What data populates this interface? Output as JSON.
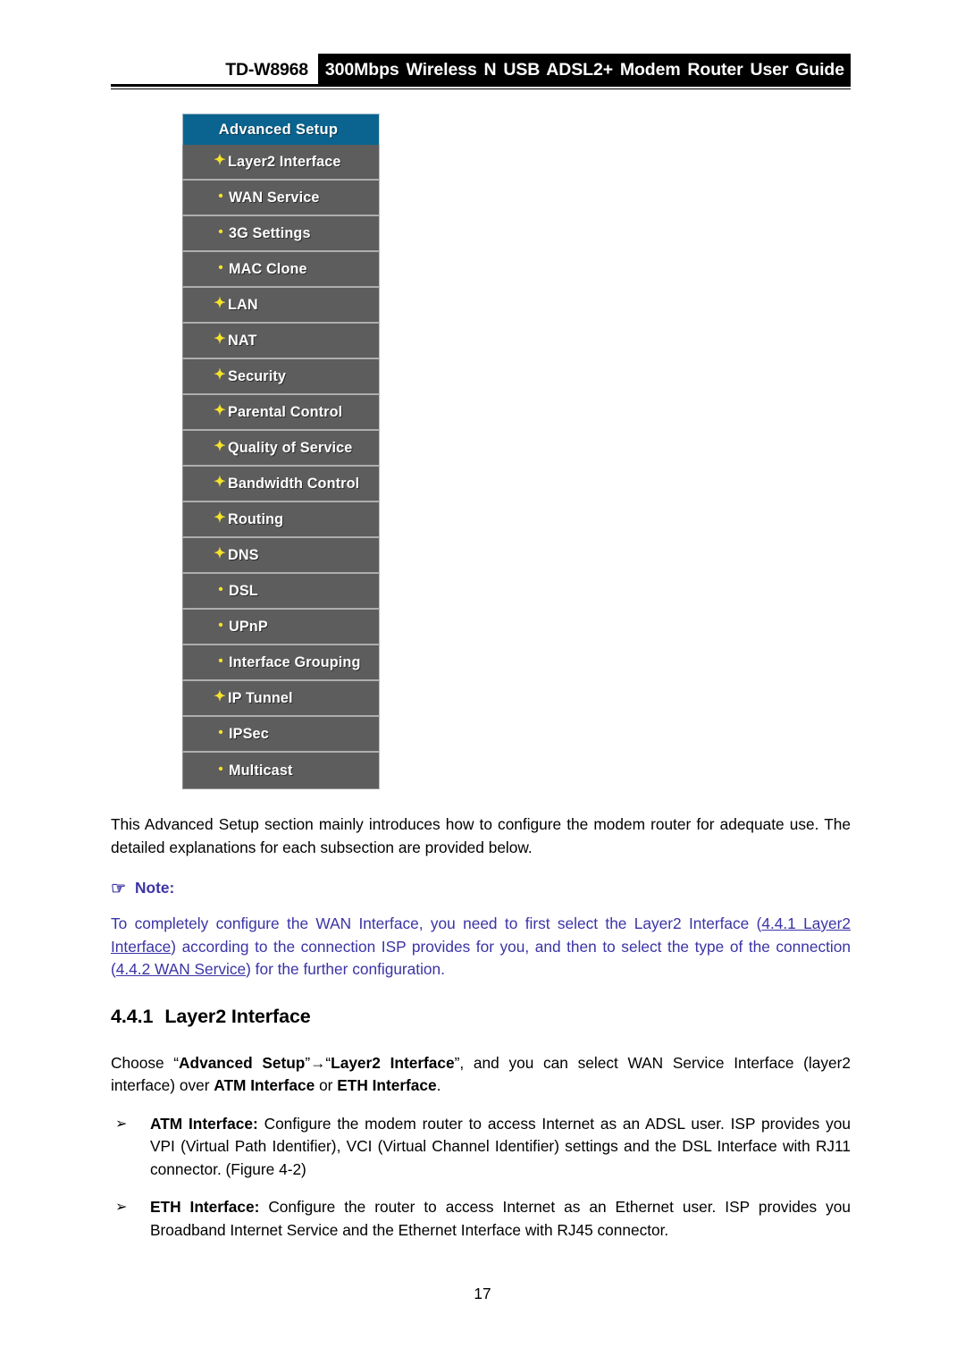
{
  "header": {
    "model": "TD-W8968",
    "title": "300Mbps Wireless N USB ADSL2+ Modem Router User Guide"
  },
  "menu": {
    "title": "Advanced Setup",
    "items": [
      {
        "label": "Layer2 Interface",
        "marker": "+",
        "marker_glyph": "✦"
      },
      {
        "label": "WAN Service",
        "marker": "•",
        "marker_glyph": "•"
      },
      {
        "label": "3G Settings",
        "marker": "•",
        "marker_glyph": "•"
      },
      {
        "label": "MAC Clone",
        "marker": "•",
        "marker_glyph": "•"
      },
      {
        "label": "LAN",
        "marker": "+",
        "marker_glyph": "✦"
      },
      {
        "label": "NAT",
        "marker": "+",
        "marker_glyph": "✦"
      },
      {
        "label": "Security",
        "marker": "+",
        "marker_glyph": "✦"
      },
      {
        "label": "Parental Control",
        "marker": "+",
        "marker_glyph": "✦"
      },
      {
        "label": "Quality of Service",
        "marker": "+",
        "marker_glyph": "✦"
      },
      {
        "label": "Bandwidth Control",
        "marker": "+",
        "marker_glyph": "✦"
      },
      {
        "label": "Routing",
        "marker": "+",
        "marker_glyph": "✦"
      },
      {
        "label": "DNS",
        "marker": "+",
        "marker_glyph": "✦"
      },
      {
        "label": "DSL",
        "marker": "•",
        "marker_glyph": "•"
      },
      {
        "label": "UPnP",
        "marker": "•",
        "marker_glyph": "•"
      },
      {
        "label": "Interface Grouping",
        "marker": "•",
        "marker_glyph": "•"
      },
      {
        "label": "IP Tunnel",
        "marker": "+",
        "marker_glyph": "✦"
      },
      {
        "label": "IPSec",
        "marker": "•",
        "marker_glyph": "•"
      },
      {
        "label": "Multicast",
        "marker": "•",
        "marker_glyph": "•"
      }
    ]
  },
  "body": {
    "intro": "This Advanced Setup section mainly introduces how to configure the modem router for adequate use. The detailed explanations for each subsection are provided below.",
    "note_label": "Note:",
    "note_hand_icon": "☞",
    "note": {
      "part1": "To completely configure the WAN Interface, you need to first select the Layer2 Interface (",
      "link1": "4.4.1 Layer2 Interface",
      "part2": ") according to the connection ISP provides for you, and then to select the type of the connection (",
      "link2": "4.4.2 WAN Service",
      "part3": ") for the further configuration."
    },
    "section_number": "4.4.1",
    "section_title": "Layer2 Interface",
    "choose": {
      "pre": "Choose “",
      "bold1": "Advanced Setup",
      "arrow": "”→“",
      "bold2": "Layer2 Interface",
      "mid": "”, and you can select WAN Service Interface (layer2 interface) over ",
      "bold3": "ATM Interface",
      "or": " or ",
      "bold4": "ETH Interface",
      "end": "."
    },
    "bullets": [
      {
        "marker": "➢",
        "term": "ATM Interface:",
        "text": " Configure the modem router to access Internet as an ADSL user. ISP provides you VPI (Virtual Path Identifier), VCI (Virtual Channel Identifier) settings and the DSL Interface with RJ11 connector. (Figure 4-2)"
      },
      {
        "marker": "➢",
        "term": "ETH Interface:",
        "text": " Configure the router to access Internet as an Ethernet user. ISP provides you Broadband Internet Service and the Ethernet Interface with RJ45 connector."
      }
    ]
  },
  "footer": {
    "page_number": "17"
  },
  "colors": {
    "menu_header_bg": "#0b6490",
    "menu_item_bg": "#5d5d5d",
    "menu_marker": "#f5e32a",
    "note_blue": "#3b33a5",
    "header_box_bg": "#000000"
  }
}
